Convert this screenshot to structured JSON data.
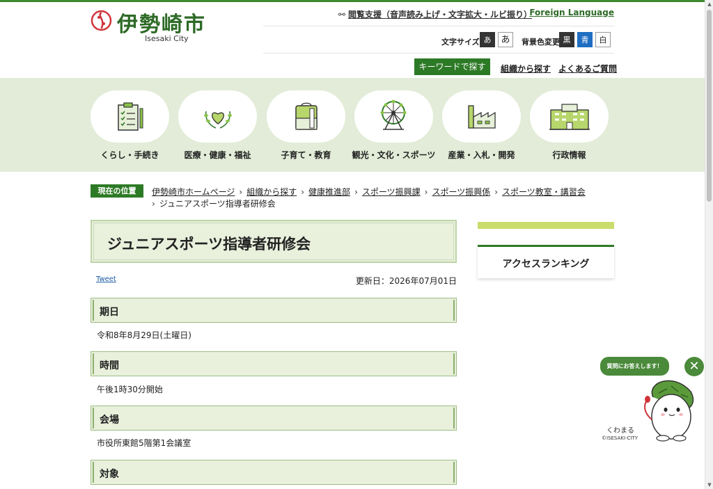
{
  "header": {
    "logo_name": "伊勢崎市",
    "logo_en": "Isesaki City",
    "reader_link": "閲覧支援（音声読み上げ・文字拡大・ルビ振り）",
    "foreign_link": "Foreign Language",
    "font_size_label": "文字サイズ",
    "font_size_small": "あ",
    "font_size_large": "あ",
    "bg_color_label": "背景色変更",
    "bg_black": "黒",
    "bg_blue": "青",
    "bg_white": "白",
    "keyword_search": "キーワードで探す",
    "org_search": "組織から探す",
    "faq": "よくあるご質問"
  },
  "categories": [
    {
      "label": "くらし・手続き",
      "icon": "clipboard-icon"
    },
    {
      "label": "医療・健康・福祉",
      "icon": "heart-laurel-icon"
    },
    {
      "label": "子育て・教育",
      "icon": "backpack-icon"
    },
    {
      "label": "観光・文化・スポーツ",
      "icon": "ferris-wheel-icon"
    },
    {
      "label": "産業・入札・開発",
      "icon": "factory-icon"
    },
    {
      "label": "行政情報",
      "icon": "city-hall-icon"
    }
  ],
  "breadcrumb": {
    "tag": "現在の位置",
    "items": [
      "伊勢崎市ホームページ",
      "組織から探す",
      "健康推進部",
      "スポーツ振興課",
      "スポーツ振興係",
      "スポーツ教室・講習会"
    ],
    "current": "ジュニアスポーツ指導者研修会"
  },
  "page": {
    "title": "ジュニアスポーツ指導者研修会",
    "tweet": "Tweet",
    "updated": "更新日：2026年07月01日",
    "sections": [
      {
        "heading": "期日",
        "body": "令和8年8月29日(土曜日)"
      },
      {
        "heading": "時間",
        "body": "午後1時30分開始"
      },
      {
        "heading": "会場",
        "body": "市役所東館5階第1会議室"
      },
      {
        "heading": "対象",
        "body": ""
      }
    ]
  },
  "sidebar": {
    "ranking_title": "アクセスランキング"
  },
  "mascot": {
    "bubble": "質問にお答えします！",
    "close": "✕",
    "name": "くわまる",
    "copyright": "©ISESAKI-CITY"
  },
  "colors": {
    "brand_green": "#2d7a26",
    "nav_bg": "#e2ecd8",
    "accent_lime": "#c9dc6c"
  }
}
